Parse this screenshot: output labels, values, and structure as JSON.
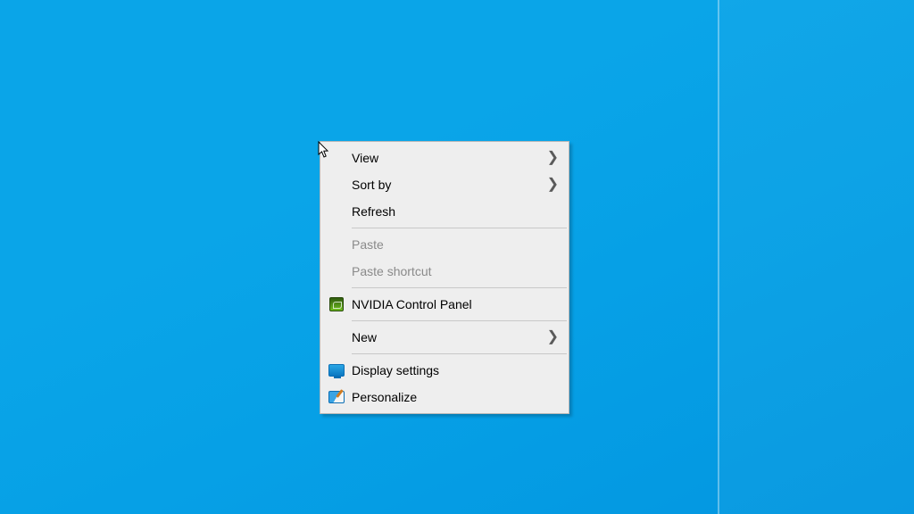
{
  "contextMenu": {
    "view": "View",
    "sortBy": "Sort by",
    "refresh": "Refresh",
    "paste": "Paste",
    "pasteShortcut": "Paste shortcut",
    "nvidia": "NVIDIA Control Panel",
    "new": "New",
    "displaySettings": "Display settings",
    "personalize": "Personalize"
  }
}
